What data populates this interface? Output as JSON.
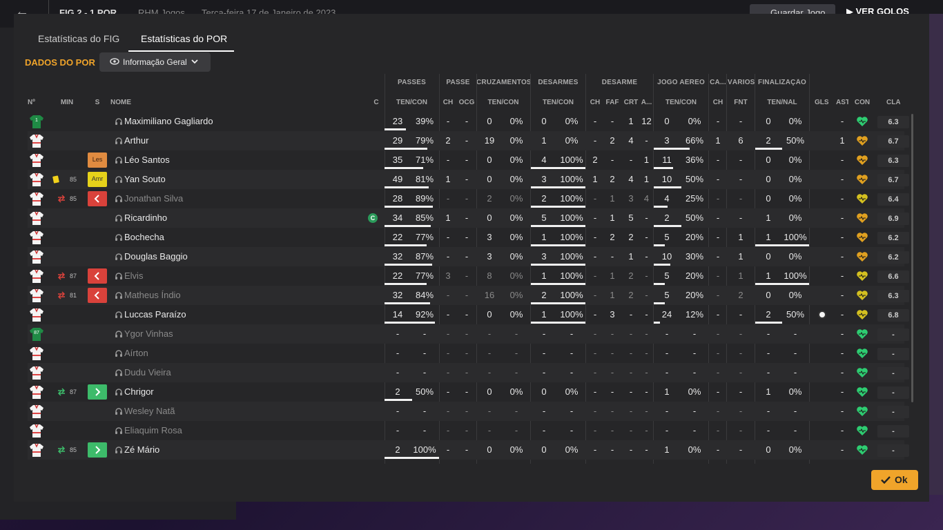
{
  "topbar": {
    "back_icon": "arrow-left-icon",
    "score": "FIG 2 - 1 POR",
    "club": "RHM Jogos",
    "date": "Terça-feira 17 de Janeiro de 2023",
    "save_label": "Guardar Jogo",
    "goals_label": "VER GOLOS"
  },
  "tabs": [
    "Estatísticas do FIG",
    "Estatísticas do POR"
  ],
  "active_tab": 1,
  "section_title": "DADOS DO POR",
  "dropdown": {
    "label": "Informação Geral",
    "icon": "eye-icon"
  },
  "group_headers": [
    "PASSES",
    "PASSE",
    "CRUZAMENTOS",
    "DESARMES",
    "DESARME",
    "JOGO AÉREO",
    "CA...",
    "VÁRIOS",
    "FINALIZAÇÃO"
  ],
  "columns": [
    "Nº",
    "MIN",
    "S",
    "NOME",
    "C",
    "TEN/CON",
    "CH",
    "OCG",
    "TEN/CON",
    "TEN/CON",
    "CH",
    "FAF",
    "CRT",
    "A...",
    "TEN/CON",
    "CH",
    "FNT",
    "TEN/NAL",
    "GLS",
    "AST",
    "CON",
    "CLA"
  ],
  "ok_label": "Ok",
  "colors": {
    "accent": "#f0a42a",
    "heart_green": "#2ecc71",
    "heart_yellow": "#d4c020",
    "heart_orange": "#e0a020",
    "sub_out": "#d9423b",
    "sub_in": "#3dbb6a",
    "pos_les": "#e08b40",
    "pos_amr": "#e6d21a"
  },
  "players": [
    {
      "no": "1",
      "kit": "gk",
      "min": "",
      "s": "",
      "name": "Maximiliano Gagliardo",
      "cap": false,
      "dim": false,
      "pa": "23",
      "pp": "39%",
      "pr": 0.39,
      "ch": "-",
      "ocg": "-",
      "cr": "0",
      "cp": "0%",
      "cr_r": 0,
      "de": "0",
      "dp": "0%",
      "de_r": 0,
      "dch": "-",
      "faf": "-",
      "crt": "1",
      "ac": "12",
      "ja": "0",
      "jp": "0%",
      "ja_r": 0,
      "cach": "-",
      "fnt": "-",
      "fi": "0",
      "fp": "0%",
      "fi_r": 0,
      "gls": "",
      "ast": "-",
      "con": "green",
      "cla": "6.3"
    },
    {
      "no": "",
      "kit": "field",
      "min": "",
      "s": "",
      "name": "Arthur",
      "cap": false,
      "dim": false,
      "pa": "29",
      "pp": "79%",
      "pr": 0.79,
      "ch": "2",
      "ocg": "-",
      "cr": "19",
      "cp": "0%",
      "cr_r": 0,
      "de": "1",
      "dp": "0%",
      "de_r": 0,
      "dch": "-",
      "faf": "2",
      "crt": "4",
      "ac": "-",
      "ja": "3",
      "jp": "66%",
      "ja_r": 0.66,
      "cach": "1",
      "fnt": "6",
      "fi": "2",
      "fp": "50%",
      "fi_r": 0.5,
      "gls": "",
      "ast": "1",
      "con": "orange",
      "cla": "6.7"
    },
    {
      "no": "",
      "kit": "field",
      "min": "",
      "s": "les",
      "name": "Léo Santos",
      "cap": false,
      "dim": false,
      "pa": "35",
      "pp": "71%",
      "pr": 0.71,
      "ch": "-",
      "ocg": "-",
      "cr": "0",
      "cp": "0%",
      "cr_r": 0,
      "de": "4",
      "dp": "100%",
      "de_r": 1,
      "dch": "2",
      "faf": "-",
      "crt": "-",
      "ac": "1",
      "ja": "11",
      "jp": "36%",
      "ja_r": 0.36,
      "cach": "-",
      "fnt": "-",
      "fi": "0",
      "fp": "0%",
      "fi_r": 0,
      "gls": "",
      "ast": "-",
      "con": "orange",
      "cla": "6.3"
    },
    {
      "no": "",
      "kit": "field",
      "min": "85",
      "s": "amr",
      "name": "Yan Souto",
      "cap": false,
      "dim": false,
      "pa": "49",
      "pp": "81%",
      "pr": 0.81,
      "ch": "1",
      "ocg": "-",
      "cr": "0",
      "cp": "0%",
      "cr_r": 0,
      "de": "3",
      "dp": "100%",
      "de_r": 1,
      "dch": "1",
      "faf": "2",
      "crt": "4",
      "ac": "1",
      "ja": "10",
      "jp": "50%",
      "ja_r": 0.5,
      "cach": "-",
      "fnt": "-",
      "fi": "0",
      "fp": "0%",
      "fi_r": 0,
      "gls": "",
      "ast": "-",
      "con": "orange",
      "cla": "6.7",
      "card": "yellow"
    },
    {
      "no": "",
      "kit": "field",
      "min": "85",
      "s": "out",
      "name": "Jonathan Silva",
      "cap": false,
      "dim": true,
      "pa": "28",
      "pp": "89%",
      "pr": 0.89,
      "ch": "-",
      "ocg": "-",
      "cr": "2",
      "cp": "0%",
      "cr_r": 0,
      "de": "2",
      "dp": "100%",
      "de_r": 1,
      "dch": "-",
      "faf": "1",
      "crt": "3",
      "ac": "4",
      "ja": "4",
      "jp": "25%",
      "ja_r": 0.25,
      "cach": "-",
      "fnt": "-",
      "fi": "0",
      "fp": "0%",
      "fi_r": 0,
      "gls": "",
      "ast": "-",
      "con": "yellow",
      "cla": "6.4"
    },
    {
      "no": "",
      "kit": "field",
      "min": "",
      "s": "",
      "name": "Ricardinho",
      "cap": true,
      "dim": false,
      "pa": "34",
      "pp": "85%",
      "pr": 0.85,
      "ch": "1",
      "ocg": "-",
      "cr": "0",
      "cp": "0%",
      "cr_r": 0,
      "de": "5",
      "dp": "100%",
      "de_r": 1,
      "dch": "-",
      "faf": "1",
      "crt": "5",
      "ac": "-",
      "ja": "2",
      "jp": "50%",
      "ja_r": 0.5,
      "cach": "-",
      "fnt": "-",
      "fi": "1",
      "fp": "0%",
      "fi_r": 0,
      "gls": "",
      "ast": "-",
      "con": "orange",
      "cla": "6.9"
    },
    {
      "no": "",
      "kit": "field",
      "min": "",
      "s": "",
      "name": "Bochecha",
      "cap": false,
      "dim": false,
      "pa": "22",
      "pp": "77%",
      "pr": 0.77,
      "ch": "-",
      "ocg": "-",
      "cr": "3",
      "cp": "0%",
      "cr_r": 0,
      "de": "1",
      "dp": "100%",
      "de_r": 1,
      "dch": "-",
      "faf": "2",
      "crt": "2",
      "ac": "-",
      "ja": "5",
      "jp": "20%",
      "ja_r": 0.2,
      "cach": "-",
      "fnt": "1",
      "fi": "1",
      "fp": "100%",
      "fi_r": 1,
      "gls": "",
      "ast": "-",
      "con": "orange",
      "cla": "6.2"
    },
    {
      "no": "",
      "kit": "field",
      "min": "",
      "s": "",
      "name": "Douglas Baggio",
      "cap": false,
      "dim": false,
      "pa": "32",
      "pp": "87%",
      "pr": 0.87,
      "ch": "-",
      "ocg": "-",
      "cr": "3",
      "cp": "0%",
      "cr_r": 0,
      "de": "3",
      "dp": "100%",
      "de_r": 1,
      "dch": "-",
      "faf": "-",
      "crt": "1",
      "ac": "-",
      "ja": "10",
      "jp": "30%",
      "ja_r": 0.3,
      "cach": "-",
      "fnt": "1",
      "fi": "0",
      "fp": "0%",
      "fi_r": 0,
      "gls": "",
      "ast": "-",
      "con": "orange",
      "cla": "6.2"
    },
    {
      "no": "",
      "kit": "field",
      "min": "87",
      "s": "out",
      "name": "Elvis",
      "cap": false,
      "dim": true,
      "pa": "22",
      "pp": "77%",
      "pr": 0.77,
      "ch": "3",
      "ocg": "-",
      "cr": "8",
      "cp": "0%",
      "cr_r": 0,
      "de": "1",
      "dp": "100%",
      "de_r": 1,
      "dch": "-",
      "faf": "1",
      "crt": "2",
      "ac": "-",
      "ja": "5",
      "jp": "20%",
      "ja_r": 0.2,
      "cach": "-",
      "fnt": "1",
      "fi": "1",
      "fp": "100%",
      "fi_r": 1,
      "gls": "",
      "ast": "-",
      "con": "yellow",
      "cla": "6.6"
    },
    {
      "no": "",
      "kit": "field",
      "min": "81",
      "s": "out",
      "name": "Matheus Índio",
      "cap": false,
      "dim": true,
      "pa": "32",
      "pp": "84%",
      "pr": 0.84,
      "ch": "-",
      "ocg": "-",
      "cr": "16",
      "cp": "0%",
      "cr_r": 0,
      "de": "2",
      "dp": "100%",
      "de_r": 1,
      "dch": "-",
      "faf": "1",
      "crt": "2",
      "ac": "-",
      "ja": "5",
      "jp": "20%",
      "ja_r": 0.2,
      "cach": "-",
      "fnt": "2",
      "fi": "0",
      "fp": "0%",
      "fi_r": 0,
      "gls": "",
      "ast": "-",
      "con": "yellow",
      "cla": "6.3"
    },
    {
      "no": "",
      "kit": "field",
      "min": "",
      "s": "",
      "name": "Luccas Paraízo",
      "cap": false,
      "dim": false,
      "pa": "14",
      "pp": "92%",
      "pr": 0.92,
      "ch": "-",
      "ocg": "-",
      "cr": "0",
      "cp": "0%",
      "cr_r": 0,
      "de": "1",
      "dp": "100%",
      "de_r": 1,
      "dch": "-",
      "faf": "3",
      "crt": "-",
      "ac": "-",
      "ja": "24",
      "jp": "12%",
      "ja_r": 0.12,
      "cach": "-",
      "fnt": "-",
      "fi": "2",
      "fp": "50%",
      "fi_r": 0.5,
      "gls": "ball",
      "ast": "-",
      "con": "yellow",
      "cla": "6.8"
    },
    {
      "no": "87",
      "kit": "gk",
      "min": "",
      "s": "",
      "name": "Ygor Vinhas",
      "cap": false,
      "dim": true,
      "pa": "-",
      "pp": "-",
      "pr": 0,
      "ch": "-",
      "ocg": "-",
      "cr": "-",
      "cp": "-",
      "cr_r": 0,
      "de": "-",
      "dp": "-",
      "de_r": 0,
      "dch": "-",
      "faf": "-",
      "crt": "-",
      "ac": "-",
      "ja": "-",
      "jp": "-",
      "ja_r": 0,
      "cach": "-",
      "fnt": "-",
      "fi": "-",
      "fp": "-",
      "fi_r": 0,
      "gls": "",
      "ast": "-",
      "con": "green",
      "cla": "-"
    },
    {
      "no": "",
      "kit": "field",
      "min": "",
      "s": "",
      "name": "Aírton",
      "cap": false,
      "dim": true,
      "pa": "-",
      "pp": "-",
      "pr": 0,
      "ch": "-",
      "ocg": "-",
      "cr": "-",
      "cp": "-",
      "cr_r": 0,
      "de": "-",
      "dp": "-",
      "de_r": 0,
      "dch": "-",
      "faf": "-",
      "crt": "-",
      "ac": "-",
      "ja": "-",
      "jp": "-",
      "ja_r": 0,
      "cach": "-",
      "fnt": "-",
      "fi": "-",
      "fp": "-",
      "fi_r": 0,
      "gls": "",
      "ast": "-",
      "con": "green",
      "cla": "-"
    },
    {
      "no": "",
      "kit": "field",
      "min": "",
      "s": "",
      "name": "Dudu Vieira",
      "cap": false,
      "dim": true,
      "pa": "-",
      "pp": "-",
      "pr": 0,
      "ch": "-",
      "ocg": "-",
      "cr": "-",
      "cp": "-",
      "cr_r": 0,
      "de": "-",
      "dp": "-",
      "de_r": 0,
      "dch": "-",
      "faf": "-",
      "crt": "-",
      "ac": "-",
      "ja": "-",
      "jp": "-",
      "ja_r": 0,
      "cach": "-",
      "fnt": "-",
      "fi": "-",
      "fp": "-",
      "fi_r": 0,
      "gls": "",
      "ast": "-",
      "con": "green",
      "cla": "-"
    },
    {
      "no": "",
      "kit": "field",
      "min": "87",
      "s": "in",
      "name": "Chrigor",
      "cap": false,
      "dim": false,
      "pa": "2",
      "pp": "50%",
      "pr": 0.5,
      "ch": "-",
      "ocg": "-",
      "cr": "0",
      "cp": "0%",
      "cr_r": 0,
      "de": "0",
      "dp": "0%",
      "de_r": 0,
      "dch": "-",
      "faf": "-",
      "crt": "-",
      "ac": "-",
      "ja": "1",
      "jp": "0%",
      "ja_r": 0,
      "cach": "-",
      "fnt": "-",
      "fi": "1",
      "fp": "0%",
      "fi_r": 0,
      "gls": "",
      "ast": "-",
      "con": "green",
      "cla": "-"
    },
    {
      "no": "",
      "kit": "field",
      "min": "",
      "s": "",
      "name": "Wesley Natã",
      "cap": false,
      "dim": true,
      "pa": "-",
      "pp": "-",
      "pr": 0,
      "ch": "-",
      "ocg": "-",
      "cr": "-",
      "cp": "-",
      "cr_r": 0,
      "de": "-",
      "dp": "-",
      "de_r": 0,
      "dch": "-",
      "faf": "-",
      "crt": "-",
      "ac": "-",
      "ja": "-",
      "jp": "-",
      "ja_r": 0,
      "cach": "-",
      "fnt": "-",
      "fi": "-",
      "fp": "-",
      "fi_r": 0,
      "gls": "",
      "ast": "-",
      "con": "green",
      "cla": "-"
    },
    {
      "no": "",
      "kit": "field",
      "min": "",
      "s": "",
      "name": "Eliaquim Rosa",
      "cap": false,
      "dim": true,
      "pa": "-",
      "pp": "-",
      "pr": 0,
      "ch": "-",
      "ocg": "-",
      "cr": "-",
      "cp": "-",
      "cr_r": 0,
      "de": "-",
      "dp": "-",
      "de_r": 0,
      "dch": "-",
      "faf": "-",
      "crt": "-",
      "ac": "-",
      "ja": "-",
      "jp": "-",
      "ja_r": 0,
      "cach": "-",
      "fnt": "-",
      "fi": "-",
      "fp": "-",
      "fi_r": 0,
      "gls": "",
      "ast": "-",
      "con": "green",
      "cla": "-"
    },
    {
      "no": "",
      "kit": "field",
      "min": "85",
      "s": "in",
      "name": "Zé Mário",
      "cap": false,
      "dim": false,
      "pa": "2",
      "pp": "100%",
      "pr": 1,
      "ch": "-",
      "ocg": "-",
      "cr": "0",
      "cp": "0%",
      "cr_r": 0,
      "de": "0",
      "dp": "0%",
      "de_r": 0,
      "dch": "-",
      "faf": "-",
      "crt": "-",
      "ac": "-",
      "ja": "1",
      "jp": "0%",
      "ja_r": 0,
      "cach": "-",
      "fnt": "-",
      "fi": "0",
      "fp": "0%",
      "fi_r": 0,
      "gls": "",
      "ast": "-",
      "con": "green",
      "cla": "-"
    }
  ]
}
